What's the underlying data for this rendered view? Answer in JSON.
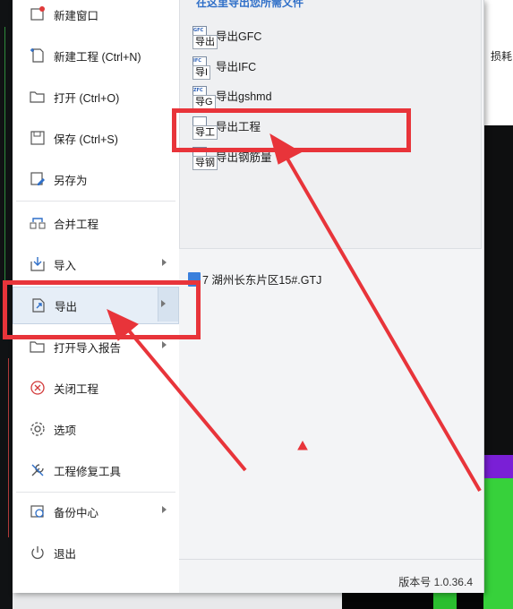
{
  "menu": {
    "items": [
      {
        "label": "新建窗口",
        "icon": "new-window-icon"
      },
      {
        "label": "新建工程 (Ctrl+N)",
        "icon": "new-project-icon"
      },
      {
        "label": "打开 (Ctrl+O)",
        "icon": "folder-open-icon"
      },
      {
        "label": "保存 (Ctrl+S)",
        "icon": "save-icon"
      },
      {
        "label": "另存为",
        "icon": "save-as-icon"
      },
      {
        "label": "合并工程",
        "icon": "merge-icon"
      },
      {
        "label": "导入",
        "icon": "import-icon"
      },
      {
        "label": "导出",
        "icon": "export-icon"
      },
      {
        "label": "打开导入报告",
        "icon": "import-report-icon"
      },
      {
        "label": "关闭工程",
        "icon": "close-project-icon"
      },
      {
        "label": "选项",
        "icon": "options-gear-icon"
      },
      {
        "label": "工程修复工具",
        "icon": "repair-tool-icon"
      },
      {
        "label": "备份中心",
        "icon": "backup-icon"
      },
      {
        "label": "退出",
        "icon": "power-icon"
      }
    ]
  },
  "export_panel": {
    "header": "在这里导出您所需文件",
    "items": [
      {
        "label": "导出GFC",
        "tag": "GFC",
        "tooltip": "导出"
      },
      {
        "label": "导出IFC",
        "tag": "IFC",
        "tooltip": "导I"
      },
      {
        "label": "导出gshmd",
        "tag": "ZFC",
        "tooltip": "导G"
      },
      {
        "label": "导出工程",
        "tag": "",
        "tooltip": "导工"
      },
      {
        "label": "导出钢筋量",
        "tag": "",
        "tooltip": "导钢"
      }
    ]
  },
  "recent_files": [
    {
      "label": "7 湖州长东片区15#.GTJ"
    }
  ],
  "version": "版本号 1.0.36.4",
  "background": {
    "label_top": "损耗",
    "label_partial": "损耗"
  },
  "colors": {
    "annotation_red": "#e8343a",
    "active_item_bg": "#e6eef7",
    "header_blue": "#2f6fc8"
  }
}
